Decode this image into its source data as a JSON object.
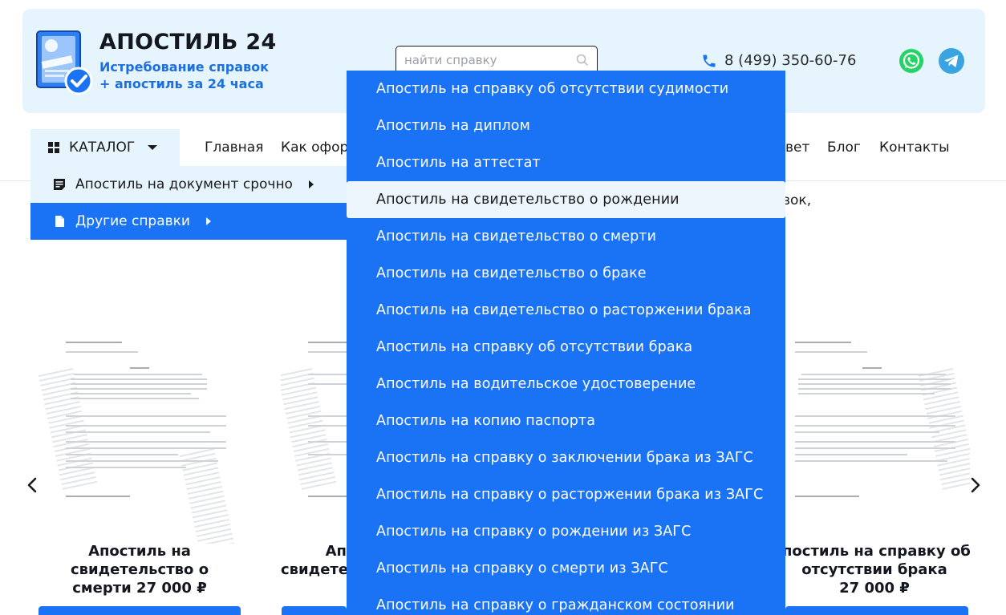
{
  "header": {
    "logo_title": "АПОСТИЛЬ 24",
    "logo_sub_line1": "Истребование справок",
    "logo_sub_line2": "+ апостиль за 24 часа",
    "search_placeholder": "найти справку",
    "phone": "8 (499) 350-60-76",
    "icons": [
      "phone-icon",
      "whatsapp-icon",
      "telegram-icon",
      "search-icon"
    ]
  },
  "nav": {
    "catalog": "КАТАЛОГ",
    "links": [
      "Главная",
      "Как офор",
      "вет",
      "Блог",
      "Контакты"
    ]
  },
  "submenu": {
    "items": [
      "Апостиль на документ срочно",
      "Другие справки"
    ],
    "active_index": 1
  },
  "intro_fragment": "вок,",
  "dropdown": {
    "items": [
      "Апостиль на справку об отсутствии судимости",
      "Апостиль на диплом",
      "Апостиль на аттестат",
      "Апостиль на свидетельство о рождении",
      "Апостиль на свидетельство о смерти",
      "Апостиль на свидетельство о браке",
      "Апостиль на свидетельство о расторжении брака",
      "Апостиль на справку об отсутствии брака",
      "Апостиль на водительское удостоверение",
      "Апостиль на копию паспорта",
      "Апостиль на справку о заключении брака из ЗАГС",
      "Апостиль на справку о расторжении брака из ЗАГС",
      "Апостиль на справку о рождении из ЗАГС",
      "Апостиль на справку о смерти из ЗАГС",
      "Апостиль на справку о гражданском состоянии"
    ],
    "active_index": 3
  },
  "cards": [
    {
      "title_line1": "Апостиль на",
      "title_line2": "свидетельство о",
      "title_line3": "смерти 27 000 ₽"
    },
    {
      "title_line1": "Ап",
      "title_line2": "свидете",
      "title_line3": ""
    },
    {
      "title_line1": "постиль на справку об",
      "title_line2": "отсутствии брака",
      "title_line3": "27 000 ₽"
    }
  ],
  "colors": {
    "accent": "#1a73f5",
    "header_bg": "#e5f4fd",
    "brand_blue_text": "#1d6fe0"
  }
}
